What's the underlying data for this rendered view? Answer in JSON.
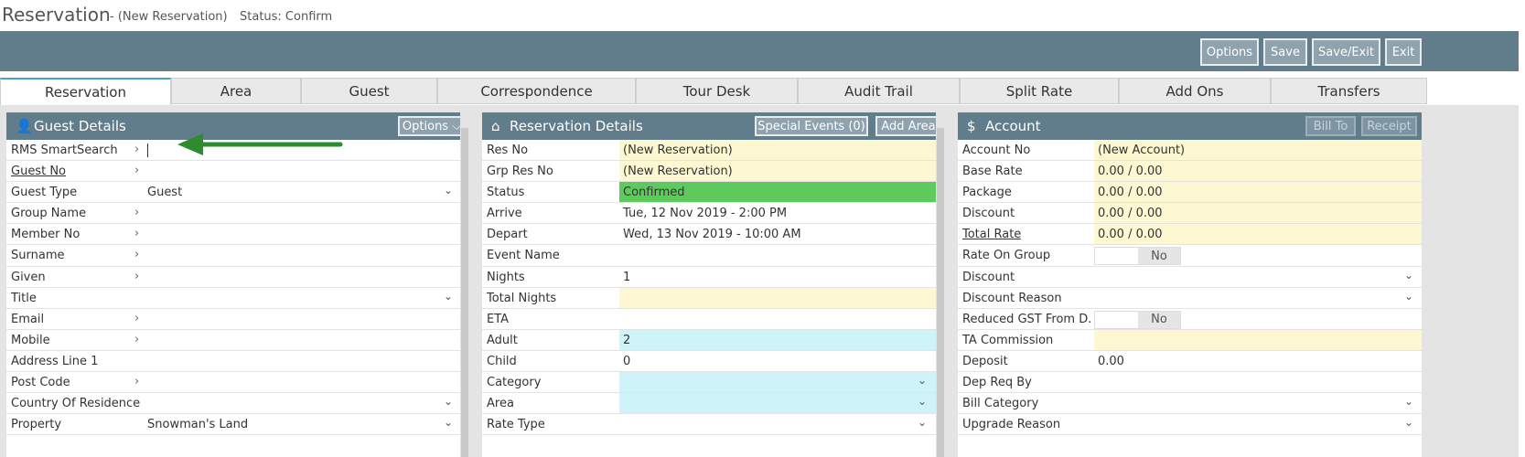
{
  "title": {
    "main": "Reservation",
    "sub": "- (New Reservation)",
    "status": "Status: Confirm"
  },
  "toolbar": {
    "options": "Options",
    "save": "Save",
    "save_exit": "Save/Exit",
    "exit": "Exit"
  },
  "tabs": [
    "Reservation",
    "Area",
    "Guest",
    "Correspondence",
    "Tour Desk",
    "Audit Trail",
    "Split Rate",
    "Add Ons",
    "Transfers"
  ],
  "guest": {
    "title": "Guest Details",
    "options": "Options ⌵",
    "rows": [
      {
        "label": "RMS SmartSearch",
        "value": ""
      },
      {
        "label": "Guest No",
        "value": ""
      },
      {
        "label": "Guest Type",
        "value": "Guest"
      },
      {
        "label": "Group Name",
        "value": ""
      },
      {
        "label": "Member No",
        "value": ""
      },
      {
        "label": "Surname",
        "value": ""
      },
      {
        "label": "Given",
        "value": ""
      },
      {
        "label": "Title",
        "value": ""
      },
      {
        "label": "Email",
        "value": ""
      },
      {
        "label": "Mobile",
        "value": ""
      },
      {
        "label": "Address Line 1",
        "value": ""
      },
      {
        "label": "Post Code",
        "value": ""
      },
      {
        "label": "Country Of Residence",
        "value": ""
      },
      {
        "label": "Property",
        "value": "Snowman's Land"
      }
    ]
  },
  "res": {
    "title": "Reservation Details",
    "special_events": "Special Events (0)",
    "add_area": "Add Area",
    "rows": [
      {
        "label": "Res No",
        "value": "(New Reservation)"
      },
      {
        "label": "Grp Res No",
        "value": "(New Reservation)"
      },
      {
        "label": "Status",
        "value": "Confirmed"
      },
      {
        "label": "Arrive",
        "value": "Tue, 12 Nov 2019 - 2:00 PM"
      },
      {
        "label": "Depart",
        "value": "Wed, 13 Nov 2019 - 10:00 AM"
      },
      {
        "label": "Event Name",
        "value": ""
      },
      {
        "label": "Nights",
        "value": "1"
      },
      {
        "label": "Total Nights",
        "value": ""
      },
      {
        "label": "ETA",
        "value": ""
      },
      {
        "label": "Adult",
        "value": "2"
      },
      {
        "label": "Child",
        "value": "0"
      },
      {
        "label": "Category",
        "value": ""
      },
      {
        "label": "Area",
        "value": ""
      },
      {
        "label": "Rate Type",
        "value": ""
      }
    ]
  },
  "account": {
    "title": "Account",
    "bill_to": "Bill To",
    "receipt": "Receipt",
    "toggle_no": "No",
    "rows": [
      {
        "label": "Account No",
        "value": "(New Account)"
      },
      {
        "label": "Base Rate",
        "value": "0.00 / 0.00"
      },
      {
        "label": "Package",
        "value": "0.00 / 0.00"
      },
      {
        "label": "Discount",
        "value": "0.00 / 0.00"
      },
      {
        "label": "Total Rate",
        "value": "0.00 / 0.00"
      },
      {
        "label": "Rate On Group",
        "value": ""
      },
      {
        "label": "Discount",
        "value": ""
      },
      {
        "label": "Discount Reason",
        "value": ""
      },
      {
        "label": "Reduced GST From D...",
        "value": ""
      },
      {
        "label": "TA Commission",
        "value": ""
      },
      {
        "label": "Deposit",
        "value": "0.00"
      },
      {
        "label": "Dep Req By",
        "value": ""
      },
      {
        "label": "Bill Category",
        "value": ""
      },
      {
        "label": "Upgrade Reason",
        "value": ""
      }
    ]
  },
  "colors": {
    "header": "#617d8c",
    "yellow": "#fdf8d2",
    "green": "#5ec95c",
    "cyan": "#cef3f8",
    "arrow": "#2e8b2e"
  }
}
